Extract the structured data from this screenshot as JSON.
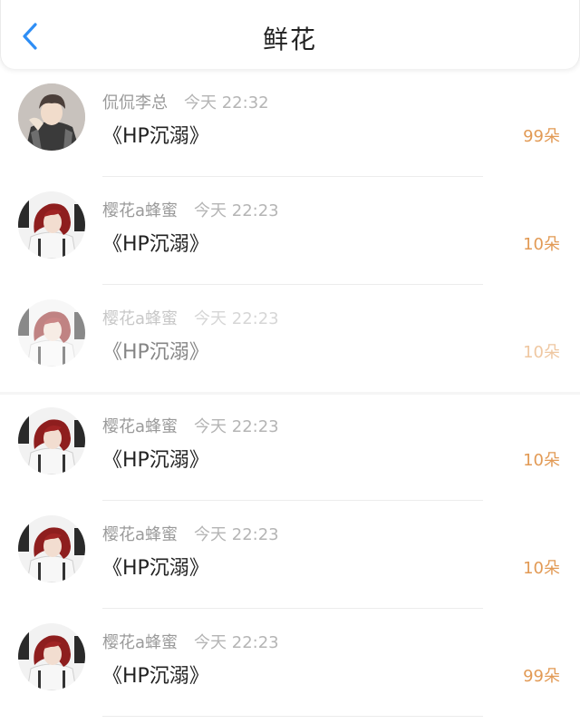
{
  "header": {
    "title": "鲜花",
    "back_icon": "chevron-left-icon",
    "accent": "#2e8ef5"
  },
  "items": [
    {
      "name": "侃侃李总",
      "time": "今天 22:32",
      "book": "《HP沉溺》",
      "count": "99朵",
      "avatar": "boy-portrait-plaid"
    },
    {
      "name": "樱花a蜂蜜",
      "time": "今天 22:23",
      "book": "《HP沉溺》",
      "count": "10朵",
      "avatar": "boy-portrait-red"
    },
    {
      "name": "樱花a蜂蜜",
      "time": "今天 22:23",
      "book": "《HP沉溺》",
      "count": "10朵",
      "avatar": "boy-portrait-red"
    },
    {
      "name": "樱花a蜂蜜",
      "time": "今天 22:23",
      "book": "《HP沉溺》",
      "count": "10朵",
      "avatar": "boy-portrait-red"
    },
    {
      "name": "樱花a蜂蜜",
      "time": "今天 22:23",
      "book": "《HP沉溺》",
      "count": "10朵",
      "avatar": "boy-portrait-red"
    },
    {
      "name": "樱花a蜂蜜",
      "time": "今天 22:23",
      "book": "《HP沉溺》",
      "count": "99朵",
      "avatar": "boy-portrait-red"
    }
  ],
  "colors": {
    "count": "#e29a55",
    "name": "#9a9a9a",
    "time": "#b5b5b5",
    "book": "#222222"
  }
}
